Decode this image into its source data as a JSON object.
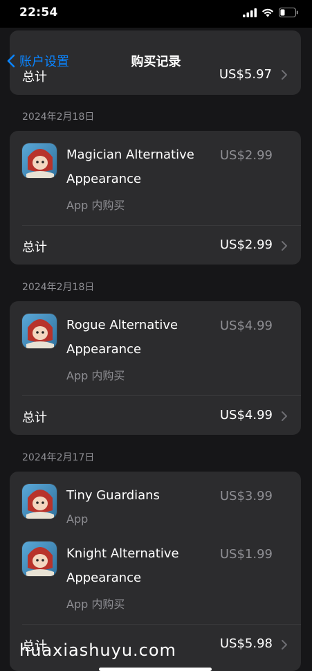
{
  "status_bar": {
    "time": "22:54"
  },
  "nav": {
    "back_label": "账户设置",
    "title": "购买记录"
  },
  "top_group": {
    "total_label": "总计",
    "total_value": "US$5.97"
  },
  "groups": [
    {
      "date": "2024年2月18日",
      "items": [
        {
          "title_line1": "Magician Alternative",
          "title_line2": "Appearance",
          "subtitle": "App 内购买",
          "price": "US$2.99"
        }
      ],
      "total_label": "总计",
      "total_value": "US$2.99"
    },
    {
      "date": "2024年2月18日",
      "items": [
        {
          "title_line1": "Rogue Alternative",
          "title_line2": "Appearance",
          "subtitle": "App 内购买",
          "price": "US$4.99"
        }
      ],
      "total_label": "总计",
      "total_value": "US$4.99"
    },
    {
      "date": "2024年2月17日",
      "items": [
        {
          "title_line1": "Tiny Guardians",
          "subtitle": "App",
          "price": "US$3.99"
        },
        {
          "title_line1": "Knight Alternative",
          "title_line2": "Appearance",
          "subtitle": "App 内购买",
          "price": "US$1.99"
        }
      ],
      "total_label": "总计",
      "total_value": "US$5.98"
    }
  ],
  "watermark": "huaxiashuyu.com",
  "colors": {
    "accent": "#0a84ff",
    "background": "#161618",
    "card": "#2c2c2e",
    "secondary_text": "#8e8e93"
  },
  "icons": [
    "chevron-left-icon",
    "chevron-right-icon",
    "signal-icon",
    "wifi-icon",
    "battery-icon",
    "app-icon"
  ]
}
